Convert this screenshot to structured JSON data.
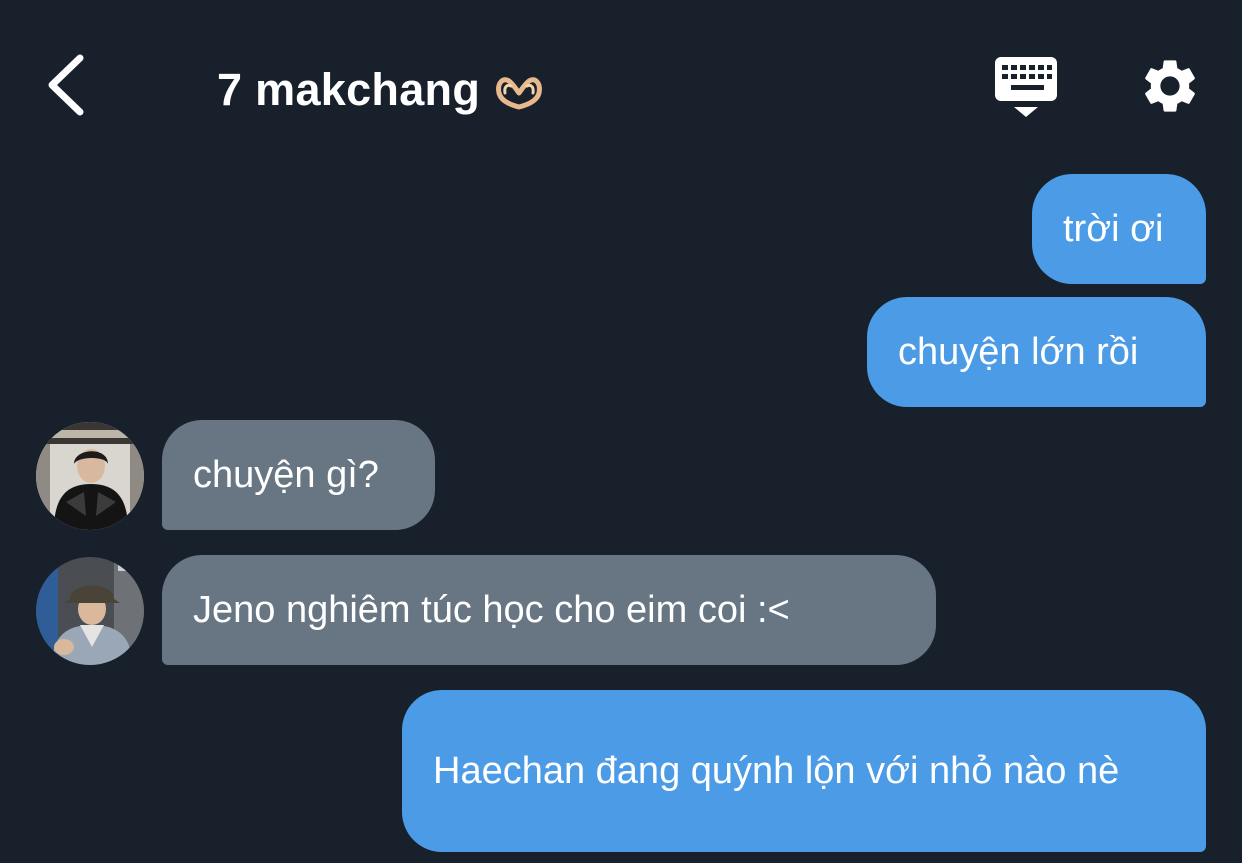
{
  "header": {
    "title": "7 makchang",
    "title_emoji": "heart-hands-emoji",
    "icons": {
      "back": "back-chevron-icon",
      "keyboard": "keyboard-icon",
      "settings": "gear-icon"
    }
  },
  "messages": [
    {
      "direction": "outgoing",
      "text": "trời ơi"
    },
    {
      "direction": "outgoing",
      "text": "chuyện lớn rồi"
    },
    {
      "direction": "incoming",
      "text": "chuyện gì?",
      "avatar": "avatar-1"
    },
    {
      "direction": "incoming",
      "text": "Jeno nghiêm túc học cho eim coi :<",
      "avatar": "avatar-2"
    },
    {
      "direction": "outgoing",
      "text": "Haechan đang quýnh lộn với nhỏ nào nè"
    }
  ],
  "colors": {
    "background": "#18202b",
    "outgoing_bubble": "#4b9be7",
    "incoming_bubble": "#687684",
    "text": "#ffffff"
  }
}
